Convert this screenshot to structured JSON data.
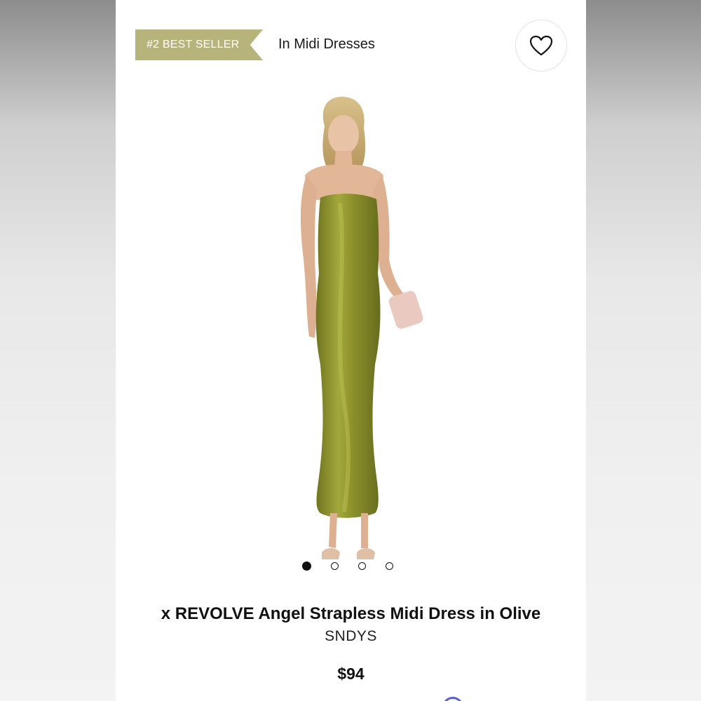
{
  "badge": {
    "rank_label": "#2 BEST SELLER",
    "context": "In Midi Dresses"
  },
  "icons": {
    "wishlist": "heart-outline-icon"
  },
  "carousel": {
    "total": 4,
    "active_index": 0
  },
  "product": {
    "title": "x REVOLVE Angel Strapless Midi Dress in Olive",
    "brand": "SNDYS",
    "price": "$94",
    "color_name": "Olive"
  },
  "colors": {
    "badge": "#b6b47a",
    "dress": "#8a8f2c",
    "text": "#111111"
  }
}
